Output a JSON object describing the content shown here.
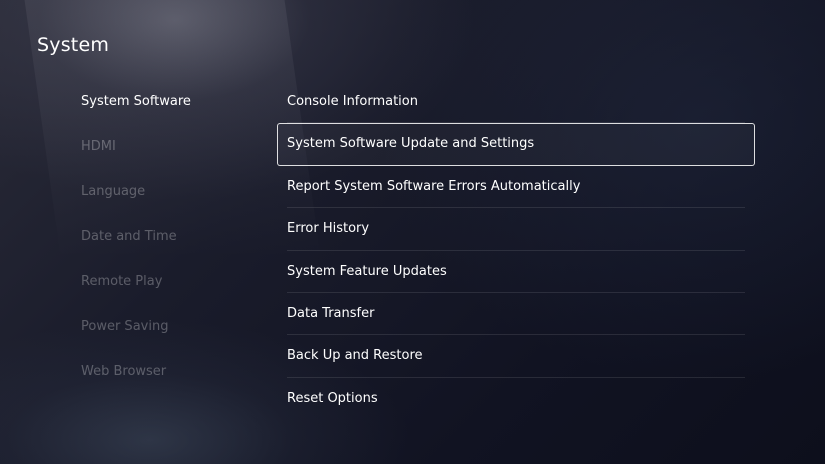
{
  "header": {
    "title": "System"
  },
  "sidebar": {
    "selected": "System Software",
    "items": [
      {
        "label": "System Software"
      },
      {
        "label": "HDMI"
      },
      {
        "label": "Language"
      },
      {
        "label": "Date and Time"
      },
      {
        "label": "Remote Play"
      },
      {
        "label": "Power Saving"
      },
      {
        "label": "Web Browser"
      }
    ]
  },
  "menu": {
    "focused": "System Software Update and Settings",
    "items": [
      {
        "label": "Console Information"
      },
      {
        "label": "System Software Update and Settings"
      },
      {
        "label": "Report System Software Errors Automatically"
      },
      {
        "label": "Error History"
      },
      {
        "label": "System Feature Updates"
      },
      {
        "label": "Data Transfer"
      },
      {
        "label": "Back Up and Restore"
      },
      {
        "label": "Reset Options"
      }
    ]
  },
  "colors": {
    "background": "#161827",
    "text": "#ffffff",
    "inactive_text": "#6b6d78",
    "focus_border": "#d9d9dd"
  }
}
